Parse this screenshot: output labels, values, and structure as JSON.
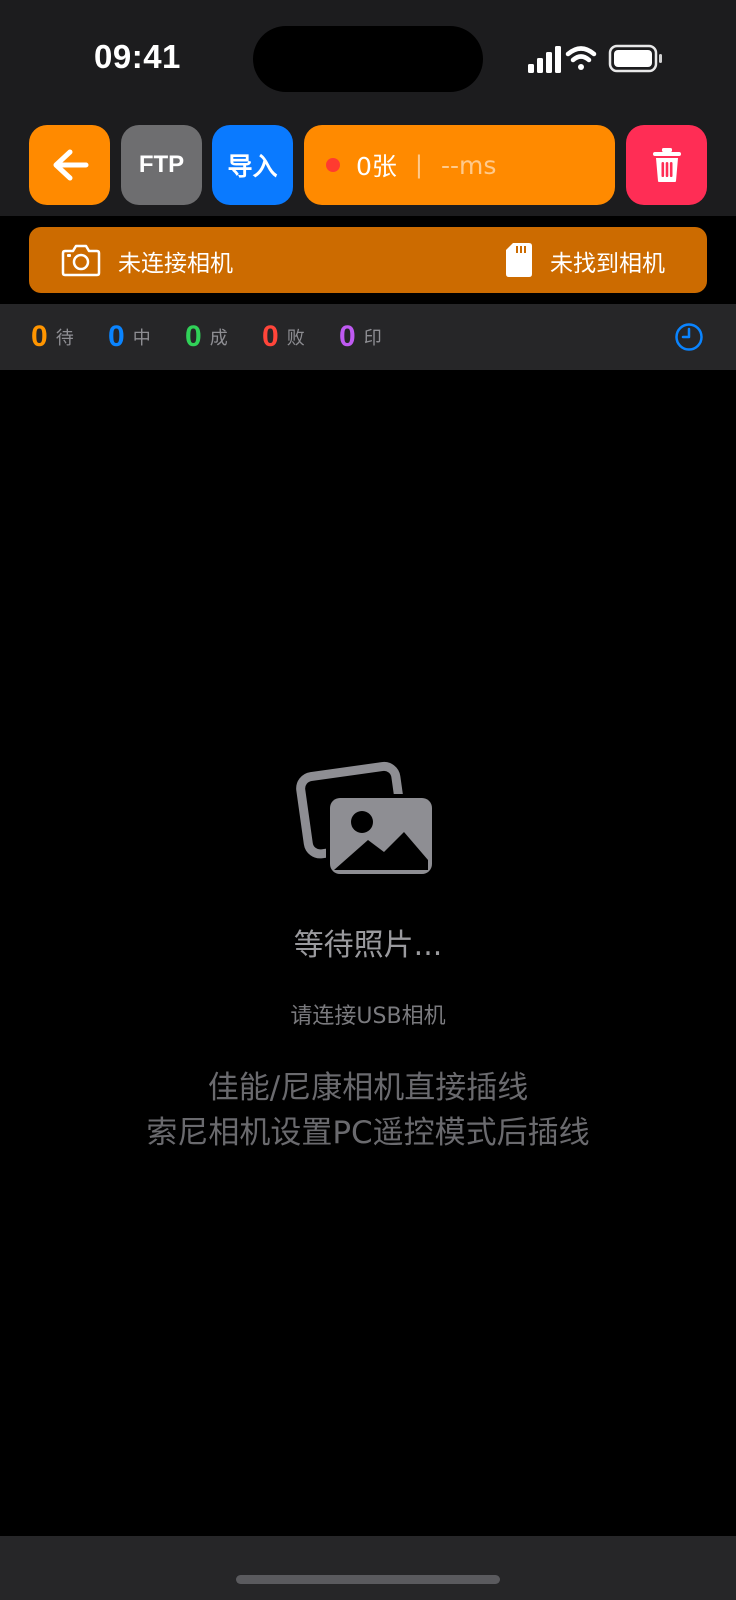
{
  "status_bar": {
    "time": "09:41",
    "icons": [
      "signal-icon",
      "wifi-icon",
      "battery-icon"
    ]
  },
  "toolbar": {
    "back_icon": "arrow-left-icon",
    "ftp_label": "FTP",
    "import_label": "导入",
    "photo_count": "0张",
    "separator": "|",
    "latency": "--ms",
    "delete_icon": "trash-icon"
  },
  "camera_banner": {
    "camera_icon": "camera-icon",
    "camera_status": "未连接相机",
    "sd_icon": "sd-card-icon",
    "card_status": "未找到相机"
  },
  "stats": [
    {
      "value": "0",
      "label": "待",
      "color": "#ff9500"
    },
    {
      "value": "0",
      "label": "中",
      "color": "#0a84ff"
    },
    {
      "value": "0",
      "label": "成",
      "color": "#30d158"
    },
    {
      "value": "0",
      "label": "败",
      "color": "#ff453a"
    },
    {
      "value": "0",
      "label": "印",
      "color": "#bf5af2"
    }
  ],
  "history_icon": "clock-icon",
  "empty_state": {
    "icon": "photos-icon",
    "title": "等待照片...",
    "subtitle": "请连接USB相机",
    "instructions": [
      "佳能/尼康相机直接插线",
      "索尼相机设置PC遥控模式后插线"
    ]
  },
  "colors": {
    "orange": "#ff8a00",
    "gray_button": "#6e6e70",
    "blue": "#0a7aff",
    "red": "#ff2d55",
    "banner": "#cc6b00"
  }
}
